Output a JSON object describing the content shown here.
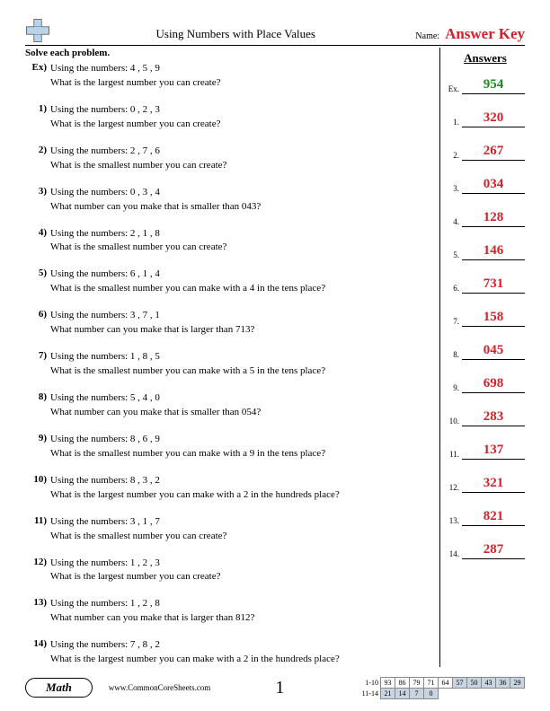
{
  "header": {
    "title": "Using Numbers with Place Values",
    "name_label": "Name:",
    "answer_key": "Answer Key"
  },
  "instruction": "Solve each problem.",
  "answers_title": "Answers",
  "problems": [
    {
      "num": "Ex)",
      "line1": "Using the numbers: 4 , 5 , 9",
      "line2": "What is the largest number you can create?"
    },
    {
      "num": "1)",
      "line1": "Using the numbers: 0 , 2 , 3",
      "line2": "What is the largest number you can create?"
    },
    {
      "num": "2)",
      "line1": "Using the numbers: 2 , 7 , 6",
      "line2": "What is the smallest number you can create?"
    },
    {
      "num": "3)",
      "line1": "Using the numbers: 0 , 3 , 4",
      "line2": "What number can you make that is smaller than 043?"
    },
    {
      "num": "4)",
      "line1": "Using the numbers: 2 , 1 , 8",
      "line2": "What is the smallest number you can create?"
    },
    {
      "num": "5)",
      "line1": "Using the numbers: 6 , 1 , 4",
      "line2": "What is the smallest number you can make with a 4 in the tens place?"
    },
    {
      "num": "6)",
      "line1": "Using the numbers: 3 , 7 , 1",
      "line2": "What number can you make that is larger than 713?"
    },
    {
      "num": "7)",
      "line1": "Using the numbers: 1 , 8 , 5",
      "line2": "What is the smallest number you can make with a 5 in the tens place?"
    },
    {
      "num": "8)",
      "line1": "Using the numbers: 5 , 4 , 0",
      "line2": "What number can you make that is smaller than 054?"
    },
    {
      "num": "9)",
      "line1": "Using the numbers: 8 , 6 , 9",
      "line2": "What is the smallest number you can make with a 9 in the tens place?"
    },
    {
      "num": "10)",
      "line1": "Using the numbers: 8 , 3 , 2",
      "line2": "What is the largest number you can make with a 2 in the hundreds place?"
    },
    {
      "num": "11)",
      "line1": "Using the numbers: 3 , 1 , 7",
      "line2": "What is the smallest number you can create?"
    },
    {
      "num": "12)",
      "line1": "Using the numbers: 1 , 2 , 3",
      "line2": "What is the largest number you can create?"
    },
    {
      "num": "13)",
      "line1": "Using the numbers: 1 , 2 , 8",
      "line2": "What number can you make that is larger than 812?"
    },
    {
      "num": "14)",
      "line1": "Using the numbers: 7 , 8 , 2",
      "line2": "What is the largest number you can make with a 2 in the hundreds place?"
    }
  ],
  "answers": [
    {
      "label": "Ex.",
      "value": "954",
      "cls": "ans-ex"
    },
    {
      "label": "1.",
      "value": "320",
      "cls": "ans-red"
    },
    {
      "label": "2.",
      "value": "267",
      "cls": "ans-red"
    },
    {
      "label": "3.",
      "value": "034",
      "cls": "ans-red"
    },
    {
      "label": "4.",
      "value": "128",
      "cls": "ans-red"
    },
    {
      "label": "5.",
      "value": "146",
      "cls": "ans-red"
    },
    {
      "label": "6.",
      "value": "731",
      "cls": "ans-red"
    },
    {
      "label": "7.",
      "value": "158",
      "cls": "ans-red"
    },
    {
      "label": "8.",
      "value": "045",
      "cls": "ans-red"
    },
    {
      "label": "9.",
      "value": "698",
      "cls": "ans-red"
    },
    {
      "label": "10.",
      "value": "283",
      "cls": "ans-red"
    },
    {
      "label": "11.",
      "value": "137",
      "cls": "ans-red"
    },
    {
      "label": "12.",
      "value": "321",
      "cls": "ans-red"
    },
    {
      "label": "13.",
      "value": "821",
      "cls": "ans-red"
    },
    {
      "label": "14.",
      "value": "287",
      "cls": "ans-red"
    }
  ],
  "footer": {
    "badge": "Math",
    "url": "www.CommonCoreSheets.com",
    "page": "1",
    "grid": {
      "row1_label": "1-10",
      "row2_label": "11-14",
      "row1": [
        "93",
        "86",
        "79",
        "71",
        "64",
        "57",
        "50",
        "43",
        "36",
        "29"
      ],
      "row2": [
        "21",
        "14",
        "7",
        "0"
      ]
    }
  }
}
